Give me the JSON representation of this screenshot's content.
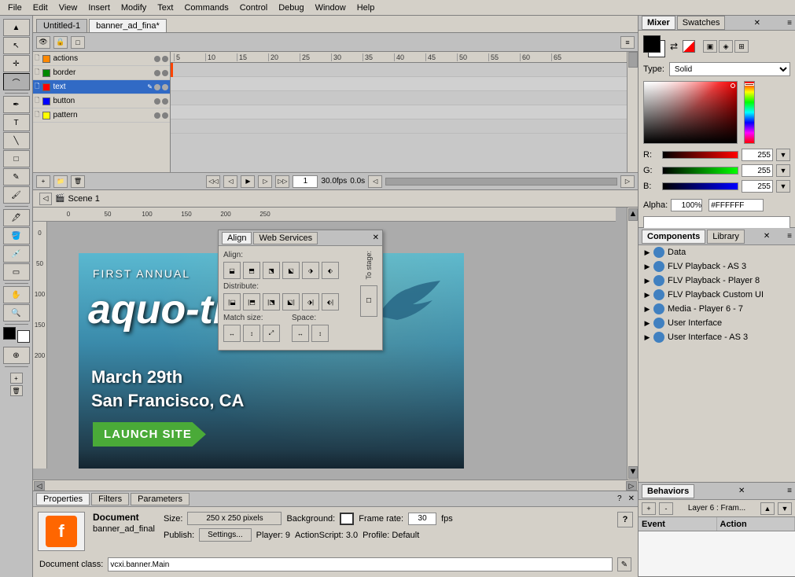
{
  "menubar": {
    "items": [
      "File",
      "Edit",
      "View",
      "Insert",
      "Modify",
      "Text",
      "Commands",
      "Control",
      "Debug",
      "Window",
      "Help"
    ]
  },
  "docTabs": [
    {
      "label": "Untitled-1",
      "active": false
    },
    {
      "label": "banner_ad_fina*",
      "active": true
    }
  ],
  "layers": [
    {
      "name": "actions",
      "color": "#ff8800",
      "visible": true,
      "locked": false,
      "selected": false
    },
    {
      "name": "border",
      "color": "#008800",
      "visible": true,
      "locked": false,
      "selected": false
    },
    {
      "name": "text",
      "color": "#ff0000",
      "visible": true,
      "locked": false,
      "selected": true
    },
    {
      "name": "button",
      "color": "#0000ff",
      "visible": true,
      "locked": false,
      "selected": false
    },
    {
      "name": "pattern",
      "color": "#ffff00",
      "visible": true,
      "locked": false,
      "selected": false
    }
  ],
  "timeline": {
    "currentFrame": "1",
    "fps": "30.0fps",
    "time": "0.0s",
    "rulerMarks": [
      "5",
      "10",
      "15",
      "20",
      "25",
      "30",
      "35",
      "40",
      "45",
      "50",
      "55",
      "60",
      "65"
    ]
  },
  "scene": {
    "label": "Scene 1"
  },
  "canvas": {
    "headline": "FIRST ANNUAL",
    "title": "aquo-thon",
    "date": "March 29th",
    "location": "San Francisco, CA",
    "buttonLabel": "LAUNCH SITE"
  },
  "mixer": {
    "tabLabel": "Mixer",
    "swatchesLabel": "Swatches",
    "typeLabel": "Type:",
    "typeValue": "Solid",
    "rLabel": "R:",
    "gLabel": "G:",
    "bLabel": "B:",
    "rValue": "255",
    "gValue": "255",
    "bValue": "255",
    "alphaLabel": "Alpha:",
    "alphaValue": "100%",
    "hexValue": "#FFFFFF"
  },
  "components": {
    "tabLabel": "Components",
    "libraryLabel": "Library",
    "items": [
      {
        "label": "Data",
        "expanded": false
      },
      {
        "label": "FLV Playback - AS 3",
        "expanded": false
      },
      {
        "label": "FLV Playback - Player 8",
        "expanded": false
      },
      {
        "label": "FLV Playback Custom UI",
        "expanded": false
      },
      {
        "label": "Media - Player 6 - 7",
        "expanded": false
      },
      {
        "label": "User Interface",
        "expanded": false
      },
      {
        "label": "User Interface - AS 3",
        "expanded": false
      }
    ]
  },
  "behaviors": {
    "tabLabel": "Behaviors",
    "layerLabel": "Layer 6 : Fram...",
    "eventColLabel": "Event",
    "actionColLabel": "Action"
  },
  "properties": {
    "propertiesTab": "Properties",
    "filtersTab": "Filters",
    "parametersTab": "Parameters",
    "docLabel": "Document",
    "docName": "banner_ad_final",
    "sizeLabel": "Size:",
    "sizeValue": "250 x 250 pixels",
    "bgLabel": "Background:",
    "fpsLabel": "Frame rate:",
    "fpsValue": "30",
    "fpsUnit": "fps",
    "publishLabel": "Publish:",
    "settingsLabel": "Settings...",
    "playerLabel": "Player: 9",
    "asLabel": "ActionScript: 3.0",
    "profileLabel": "Profile: Default",
    "docClassLabel": "Document class:",
    "docClassValue": "vcxi.banner.Main"
  },
  "align": {
    "panelLabel": "Align",
    "webServicesLabel": "Web Services",
    "alignLabel": "Align:",
    "distributeLabel": "Distribute:",
    "matchSizeLabel": "Match size:",
    "spaceLabel": "Space:",
    "toStageLabel": "To stage:"
  }
}
